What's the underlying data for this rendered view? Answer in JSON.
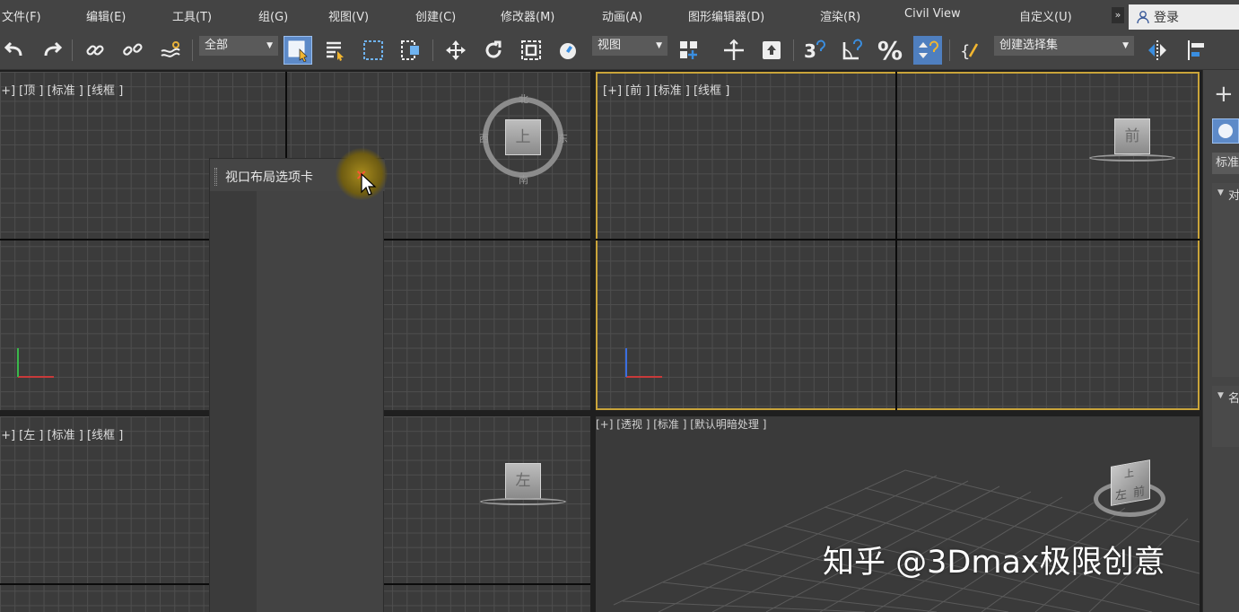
{
  "menu": {
    "items": [
      "文件(F)",
      "编辑(E)",
      "工具(T)",
      "组(G)",
      "视图(V)",
      "创建(C)",
      "修改器(M)",
      "动画(A)",
      "图形编辑器(D)",
      "渲染(R)",
      "Civil View",
      "自定义(U)"
    ],
    "more": "»",
    "login": "登录"
  },
  "toolbar": {
    "selection_filter": "全部",
    "reference_coord": "视图",
    "named_selection": "创建选择集",
    "percent": "%"
  },
  "viewports": {
    "top": {
      "label": "[+] [顶 ] [标准 ] [线框 ]"
    },
    "front": {
      "label": "[+] [前 ] [标准 ] [线框 ]",
      "cube": "前"
    },
    "left": {
      "label": "[+] [左 ] [标准 ] [线框 ]",
      "cube": "左"
    },
    "perspective": {
      "label": "[+] [透视 ] [标准 ] [默认明暗处理 ]"
    },
    "compass": {
      "n": "北",
      "s": "南",
      "e": "东",
      "w": "西",
      "center": "上"
    },
    "persp_cube": {
      "front": "前",
      "left": "左",
      "top": "上"
    }
  },
  "panel": {
    "title": "视口布局选项卡",
    "close": "×"
  },
  "command_panel": {
    "plus": "+",
    "dropdown": "标准",
    "section1": "对",
    "section2": "名"
  },
  "watermark": "知乎 @3Dmax极限创意",
  "colors": {
    "active_border": "#c9a43a",
    "accent": "#5d8ac8",
    "close": "#ff5533"
  }
}
